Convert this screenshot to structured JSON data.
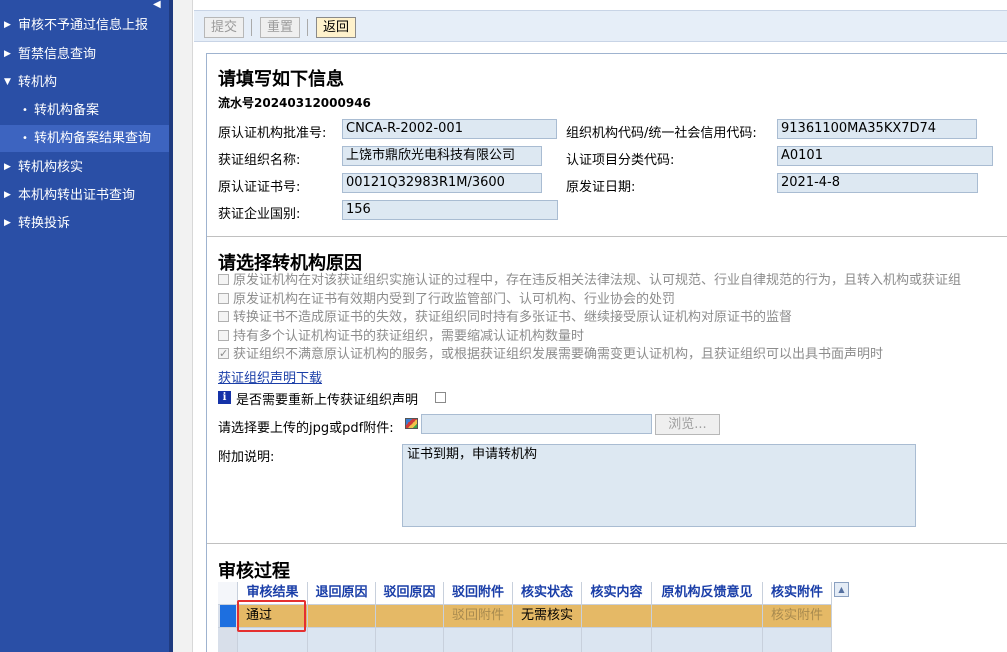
{
  "sidebar": {
    "collapse_glyph": "◀",
    "items": [
      {
        "label": "审核不予通过信息上报",
        "caret": "▶"
      },
      {
        "label": "暂禁信息查询",
        "caret": "▶"
      },
      {
        "label": "转机构",
        "caret": "▼"
      },
      {
        "label": "转机构备案",
        "caret": "•"
      },
      {
        "label": "转机构备案结果查询",
        "caret": "•"
      },
      {
        "label": "转机构核实",
        "caret": "▶"
      },
      {
        "label": "本机构转出证书查询",
        "caret": "▶"
      },
      {
        "label": "转换投诉",
        "caret": "▶"
      }
    ]
  },
  "toolbar": {
    "submit_label": "提交",
    "reset_label": "重置",
    "back_label": "返回"
  },
  "info": {
    "title": "请填写如下信息",
    "serial": "流水号20240312000946",
    "fields": {
      "orig_approval_no": {
        "label": "原认证机构批准号:",
        "value": "CNCA-R-2002-001"
      },
      "org_code": {
        "label": "组织机构代码/统一社会信用代码:",
        "value": "91361100MA35KX7D74"
      },
      "org_name": {
        "label": "获证组织名称:",
        "value": "上饶市鼎欣光电科技有限公司"
      },
      "category_code": {
        "label": "认证项目分类代码:",
        "value": "A0101"
      },
      "cert_no": {
        "label": "原认证证书号:",
        "value": "00121Q32983R1M/3600"
      },
      "issue_date": {
        "label": "原发证日期:",
        "value": "2021-4-8"
      },
      "country": {
        "label": "获证企业国别:",
        "value": "156"
      }
    }
  },
  "reason": {
    "title": "请选择转机构原因",
    "options": [
      {
        "text": "原发证机构在对该获证组织实施认证的过程中，存在违反相关法律法规、认可规范、行业自律规范的行为，且转入机构或获证组",
        "checked": false
      },
      {
        "text": "原发证机构在证书有效期内受到了行政监管部门、认可机构、行业协会的处罚",
        "checked": false
      },
      {
        "text": "转换证书不造成原证书的失效，获证组织同时持有多张证书、继续接受原认证机构对原证书的监督",
        "checked": false
      },
      {
        "text": "持有多个认证机构证书的获证组织，需要缩减认证机构数量时",
        "checked": false
      },
      {
        "text": "获证组织不满意原认证机构的服务，或根据获证组织发展需要确需变更认证机构，且获证组织可以出具书面声明时",
        "checked": true
      }
    ],
    "download_link": "获证组织声明下载",
    "reupload_label": "是否需要重新上传获证组织声明",
    "info_icon_glyph": "i",
    "upload_label": "请选择要上传的jpg或pdf附件:",
    "browse_label": "浏览...",
    "remark_label": "附加说明:",
    "remark_value": "证书到期，申请转机构"
  },
  "review": {
    "title": "审核过程",
    "columns": [
      "审核结果",
      "退回原因",
      "驳回原因",
      "驳回附件",
      "核实状态",
      "核实内容",
      "原机构反馈意见",
      "核实附件"
    ],
    "rows": [
      [
        "通过",
        "",
        "",
        "驳回附件",
        "无需核实",
        "",
        "",
        "核实附件"
      ]
    ],
    "scroll_glyph": "▲"
  },
  "colors": {
    "sidebar_bg": "#2a4fa6",
    "sidebar_active": "#3d64c0",
    "row_selected": "#e5b966",
    "highlight": "#e53030"
  }
}
